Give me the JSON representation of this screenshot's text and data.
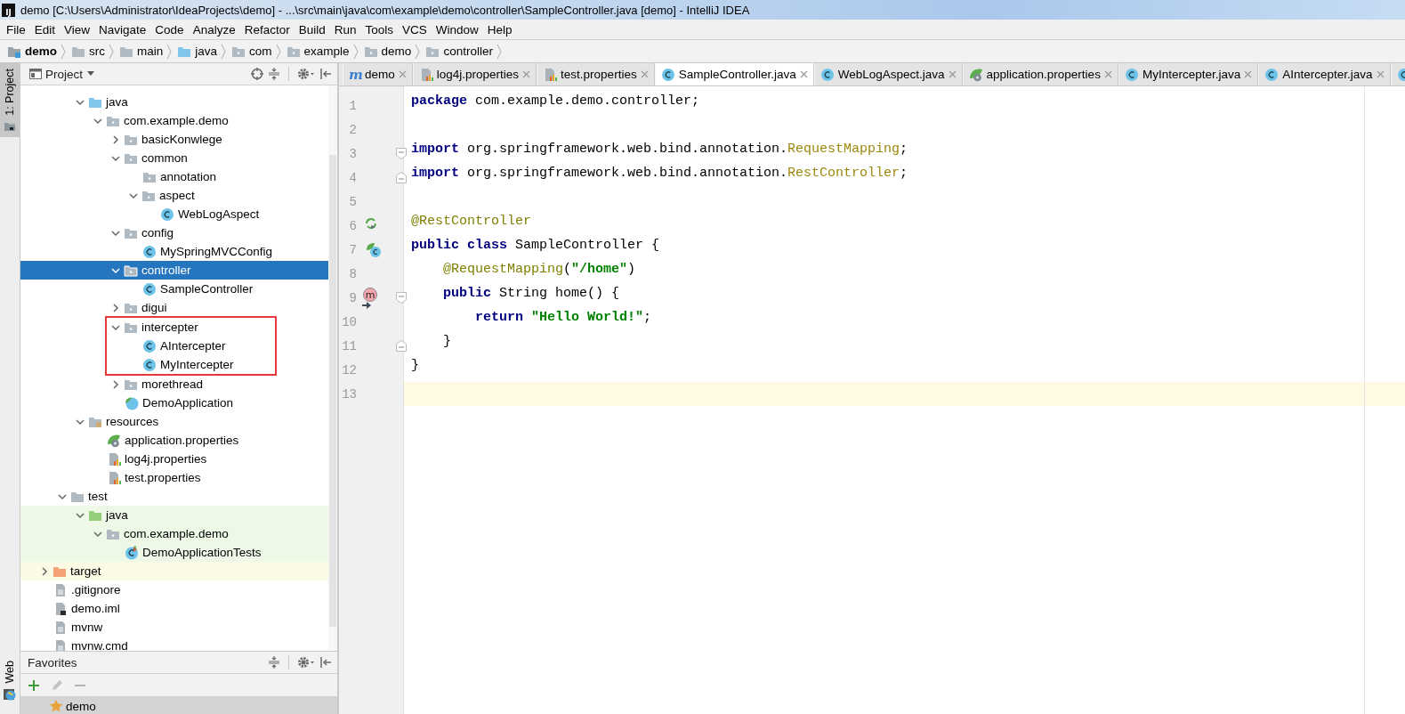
{
  "window": {
    "logo": "IJ",
    "title": "demo [C:\\Users\\Administrator\\IdeaProjects\\demo] - ...\\src\\main\\java\\com\\example\\demo\\controller\\SampleController.java [demo] - IntelliJ IDEA"
  },
  "menu": [
    "File",
    "Edit",
    "View",
    "Navigate",
    "Code",
    "Analyze",
    "Refactor",
    "Build",
    "Run",
    "Tools",
    "VCS",
    "Window",
    "Help"
  ],
  "breadcrumbs": [
    {
      "label": "demo",
      "kind": "module"
    },
    {
      "label": "src",
      "kind": "folder"
    },
    {
      "label": "main",
      "kind": "folder"
    },
    {
      "label": "java",
      "kind": "source"
    },
    {
      "label": "com",
      "kind": "package"
    },
    {
      "label": "example",
      "kind": "package"
    },
    {
      "label": "demo",
      "kind": "package"
    },
    {
      "label": "controller",
      "kind": "package"
    }
  ],
  "tool_strip": {
    "top": [
      {
        "label": "1: Project",
        "selected": true
      }
    ],
    "bottom": [
      {
        "label": "Web",
        "selected": false
      }
    ]
  },
  "project": {
    "title": "Project",
    "tree": [
      {
        "children": [
          {
            "children": [
              {
                "label": "java",
                "kind": "source",
                "expanded": true,
                "selected": false,
                "children": [
                  {
                    "label": "com.example.demo",
                    "kind": "package",
                    "expanded": true,
                    "selected": false,
                    "children": [
                      {
                        "label": "basicKonwlege",
                        "kind": "package",
                        "expanded": false,
                        "selected": false
                      },
                      {
                        "label": "common",
                        "kind": "package",
                        "expanded": true,
                        "selected": false,
                        "children": [
                          {
                            "label": "annotation",
                            "kind": "package",
                            "selected": false
                          },
                          {
                            "label": "aspect",
                            "kind": "package",
                            "expanded": true,
                            "selected": false,
                            "children": [
                              {
                                "label": "WebLogAspect",
                                "kind": "class",
                                "selected": false
                              }
                            ]
                          }
                        ]
                      },
                      {
                        "label": "config",
                        "kind": "package",
                        "expanded": true,
                        "selected": false,
                        "children": [
                          {
                            "label": "MySpringMVCConfig",
                            "kind": "class",
                            "selected": false
                          }
                        ]
                      },
                      {
                        "label": "controller",
                        "kind": "package",
                        "expanded": true,
                        "selected": true,
                        "children": [
                          {
                            "label": "SampleController",
                            "kind": "class",
                            "selected": false
                          }
                        ]
                      },
                      {
                        "label": "digui",
                        "kind": "package",
                        "expanded": false,
                        "selected": false
                      },
                      {
                        "label": "intercepter",
                        "kind": "package",
                        "expanded": true,
                        "selected": false,
                        "boxed": true,
                        "children": [
                          {
                            "label": "AIntercepter",
                            "kind": "class",
                            "selected": false
                          },
                          {
                            "label": "MyIntercepter",
                            "kind": "class",
                            "selected": false
                          }
                        ]
                      },
                      {
                        "label": "morethread",
                        "kind": "package",
                        "expanded": false,
                        "selected": false
                      },
                      {
                        "label": "DemoApplication",
                        "kind": "spring-class",
                        "selected": false
                      }
                    ]
                  }
                ]
              },
              {
                "label": "resources",
                "kind": "resources",
                "expanded": true,
                "selected": false,
                "children": [
                  {
                    "label": "application.properties",
                    "kind": "spring-props",
                    "selected": false
                  },
                  {
                    "label": "log4j.properties",
                    "kind": "props",
                    "selected": false
                  },
                  {
                    "label": "test.properties",
                    "kind": "props",
                    "selected": false
                  }
                ]
              }
            ]
          },
          {
            "label": "test",
            "kind": "folder",
            "expanded": true,
            "selected": false,
            "children": [
              {
                "label": "java",
                "kind": "test-source",
                "expanded": true,
                "selected": false,
                "test_root": true,
                "children": [
                  {
                    "label": "com.example.demo",
                    "kind": "package",
                    "expanded": true,
                    "selected": false,
                    "test_root": true,
                    "children": [
                      {
                        "label": "DemoApplicationTests",
                        "kind": "test-class",
                        "selected": false,
                        "test_root": true
                      }
                    ]
                  }
                ]
              }
            ]
          }
        ]
      },
      {
        "label": "target",
        "kind": "excluded",
        "expanded": false,
        "selected": false,
        "excluded": true
      },
      {
        "label": ".gitignore",
        "kind": "file",
        "selected": false
      },
      {
        "label": "demo.iml",
        "kind": "iml",
        "selected": false
      },
      {
        "label": "mvnw",
        "kind": "file",
        "selected": false
      },
      {
        "label": "mvnw.cmd",
        "kind": "file",
        "selected": false
      }
    ]
  },
  "favorites": {
    "title": "Favorites",
    "items": [
      {
        "label": "demo",
        "selected": true
      }
    ]
  },
  "tabs": [
    {
      "label": "demo",
      "kind": "maven",
      "icon_text": "m",
      "selected": false
    },
    {
      "label": "log4j.properties",
      "kind": "props",
      "selected": false
    },
    {
      "label": "test.properties",
      "kind": "props",
      "selected": false
    },
    {
      "label": "SampleController.java",
      "kind": "class",
      "selected": true
    },
    {
      "label": "WebLogAspect.java",
      "kind": "class",
      "selected": false
    },
    {
      "label": "application.properties",
      "kind": "spring-props",
      "selected": false
    },
    {
      "label": "MyIntercepter.java",
      "kind": "class",
      "selected": false
    },
    {
      "label": "AIntercepter.java",
      "kind": "class",
      "selected": false
    },
    {
      "kind": "class",
      "selected": false
    }
  ],
  "editor": {
    "lines": [
      {
        "number": "1",
        "current": false,
        "segments": [
          {
            "text": "package",
            "kind": "keyword"
          },
          {
            "text": " com.example.demo.controller;",
            "kind": "plain"
          }
        ]
      },
      {
        "number": "2",
        "current": false
      },
      {
        "number": "3",
        "current": false,
        "fold_start": true,
        "segments": [
          {
            "text": "import",
            "kind": "keyword"
          },
          {
            "text": " org.springframework.web.bind.annotation.",
            "kind": "plain"
          },
          {
            "text": "RequestMapping",
            "kind": "unused"
          },
          {
            "text": ";",
            "kind": "plain"
          }
        ]
      },
      {
        "number": "4",
        "current": false,
        "fold_end": true,
        "segments": [
          {
            "text": "import",
            "kind": "keyword"
          },
          {
            "text": " org.springframework.web.bind.annotation.",
            "kind": "plain"
          },
          {
            "text": "RestController",
            "kind": "unused"
          },
          {
            "text": ";",
            "kind": "plain"
          }
        ]
      },
      {
        "number": "5",
        "current": false
      },
      {
        "number": "6",
        "current": false,
        "gutter": {
          "kind": "bean"
        },
        "segments": [
          {
            "text": "@RestController",
            "kind": "annotation"
          }
        ]
      },
      {
        "number": "7",
        "current": false,
        "gutter": {
          "kind": "spring-class"
        },
        "segments": [
          {
            "text": "public class",
            "kind": "keyword"
          },
          {
            "text": " SampleController {",
            "kind": "plain"
          }
        ]
      },
      {
        "number": "8",
        "current": false,
        "segments": [
          {
            "text": "    @RequestMapping",
            "kind": "annotation"
          },
          {
            "text": "(",
            "kind": "plain"
          },
          {
            "text": "\"/home\"",
            "kind": "string"
          },
          {
            "text": ")",
            "kind": "plain"
          }
        ]
      },
      {
        "number": "9",
        "current": false,
        "fold_start": true,
        "gutter": {
          "kind": "method",
          "text": "m"
        },
        "segments": [
          {
            "text": "    public",
            "kind": "keyword"
          },
          {
            "text": " String home() {",
            "kind": "plain"
          }
        ]
      },
      {
        "number": "10",
        "current": false,
        "segments": [
          {
            "text": "        return",
            "kind": "keyword"
          },
          {
            "text": " \"Hello World!\"",
            "kind": "string"
          },
          {
            "text": ";",
            "kind": "plain"
          }
        ]
      },
      {
        "number": "11",
        "current": false,
        "fold_end": true,
        "segments": [
          {
            "text": "    }",
            "kind": "plain"
          }
        ]
      },
      {
        "number": "12",
        "current": false,
        "segments": [
          {
            "text": "}",
            "kind": "plain"
          }
        ]
      },
      {
        "number": "13",
        "current": true
      }
    ]
  }
}
